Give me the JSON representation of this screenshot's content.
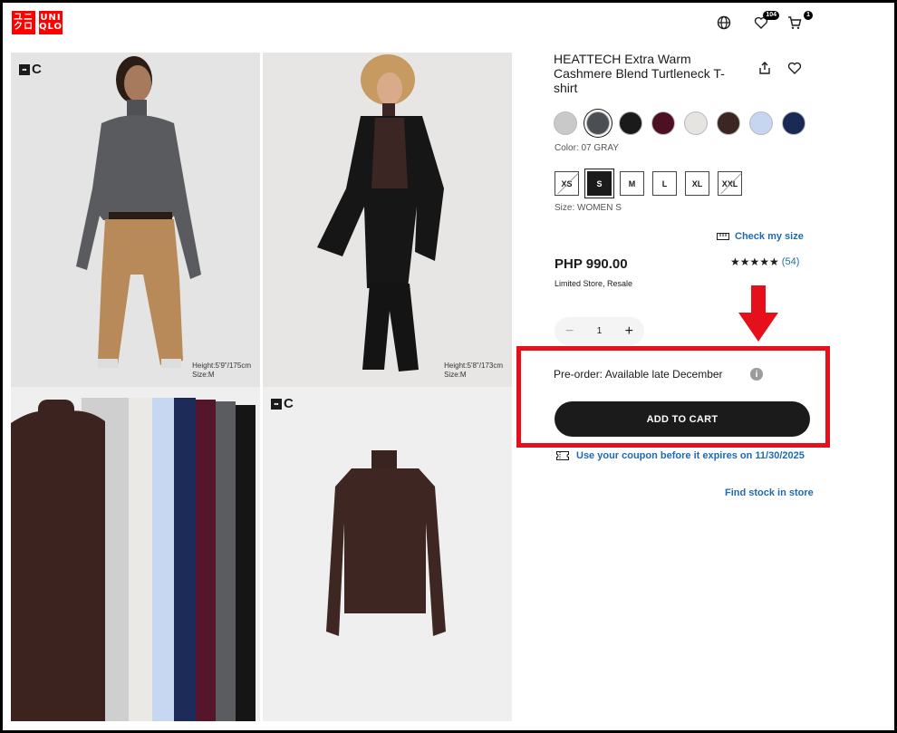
{
  "header": {
    "logo_top": "ユニクロ",
    "logo_bottom": "UNIQLO",
    "logo_lines": [
      "ユニ",
      "クロ",
      "UNI",
      "QLO"
    ],
    "wishlist_count": "104",
    "cart_count": "1"
  },
  "gallery": {
    "brand_mark": "C",
    "model1_info": [
      "Height:5'9\"/175cm",
      "Size:M"
    ],
    "model2_info": [
      "Height:5'8\"/173cm",
      "Size:M"
    ]
  },
  "product": {
    "title": "HEATTECH Extra Warm Cashmere Blend Turtleneck T-shirt",
    "color_label": "Color: 07 GRAY",
    "colors": [
      "#c9c9c9",
      "#4b4e53",
      "#1a1a1a",
      "#4d0f22",
      "#e6e4e1",
      "#3b2624",
      "#c6d6f0",
      "#1a2a57"
    ],
    "selected_color_index": 1,
    "sizes": [
      "XS",
      "S",
      "M",
      "L",
      "XL",
      "XXL"
    ],
    "size_label": "Size: WOMEN S",
    "check_size": "Check my size",
    "price": "PHP 990.00",
    "rating_stars": "★★★★★",
    "review_count": "(54)",
    "availability": "Limited Store, Resale",
    "quantity": "1",
    "qty_minus": "−",
    "qty_plus": "+",
    "preorder_text": "Pre-order: Available late December",
    "info_glyph": "i",
    "add_to_cart": "ADD TO CART",
    "coupon_text": "Use your coupon before it expires on 11/30/2025",
    "find_stock": "Find stock in store"
  },
  "colors": {
    "brand_red": "#ff0000",
    "highlight_red": "#e5101b",
    "link_blue": "#1f6ab5"
  }
}
